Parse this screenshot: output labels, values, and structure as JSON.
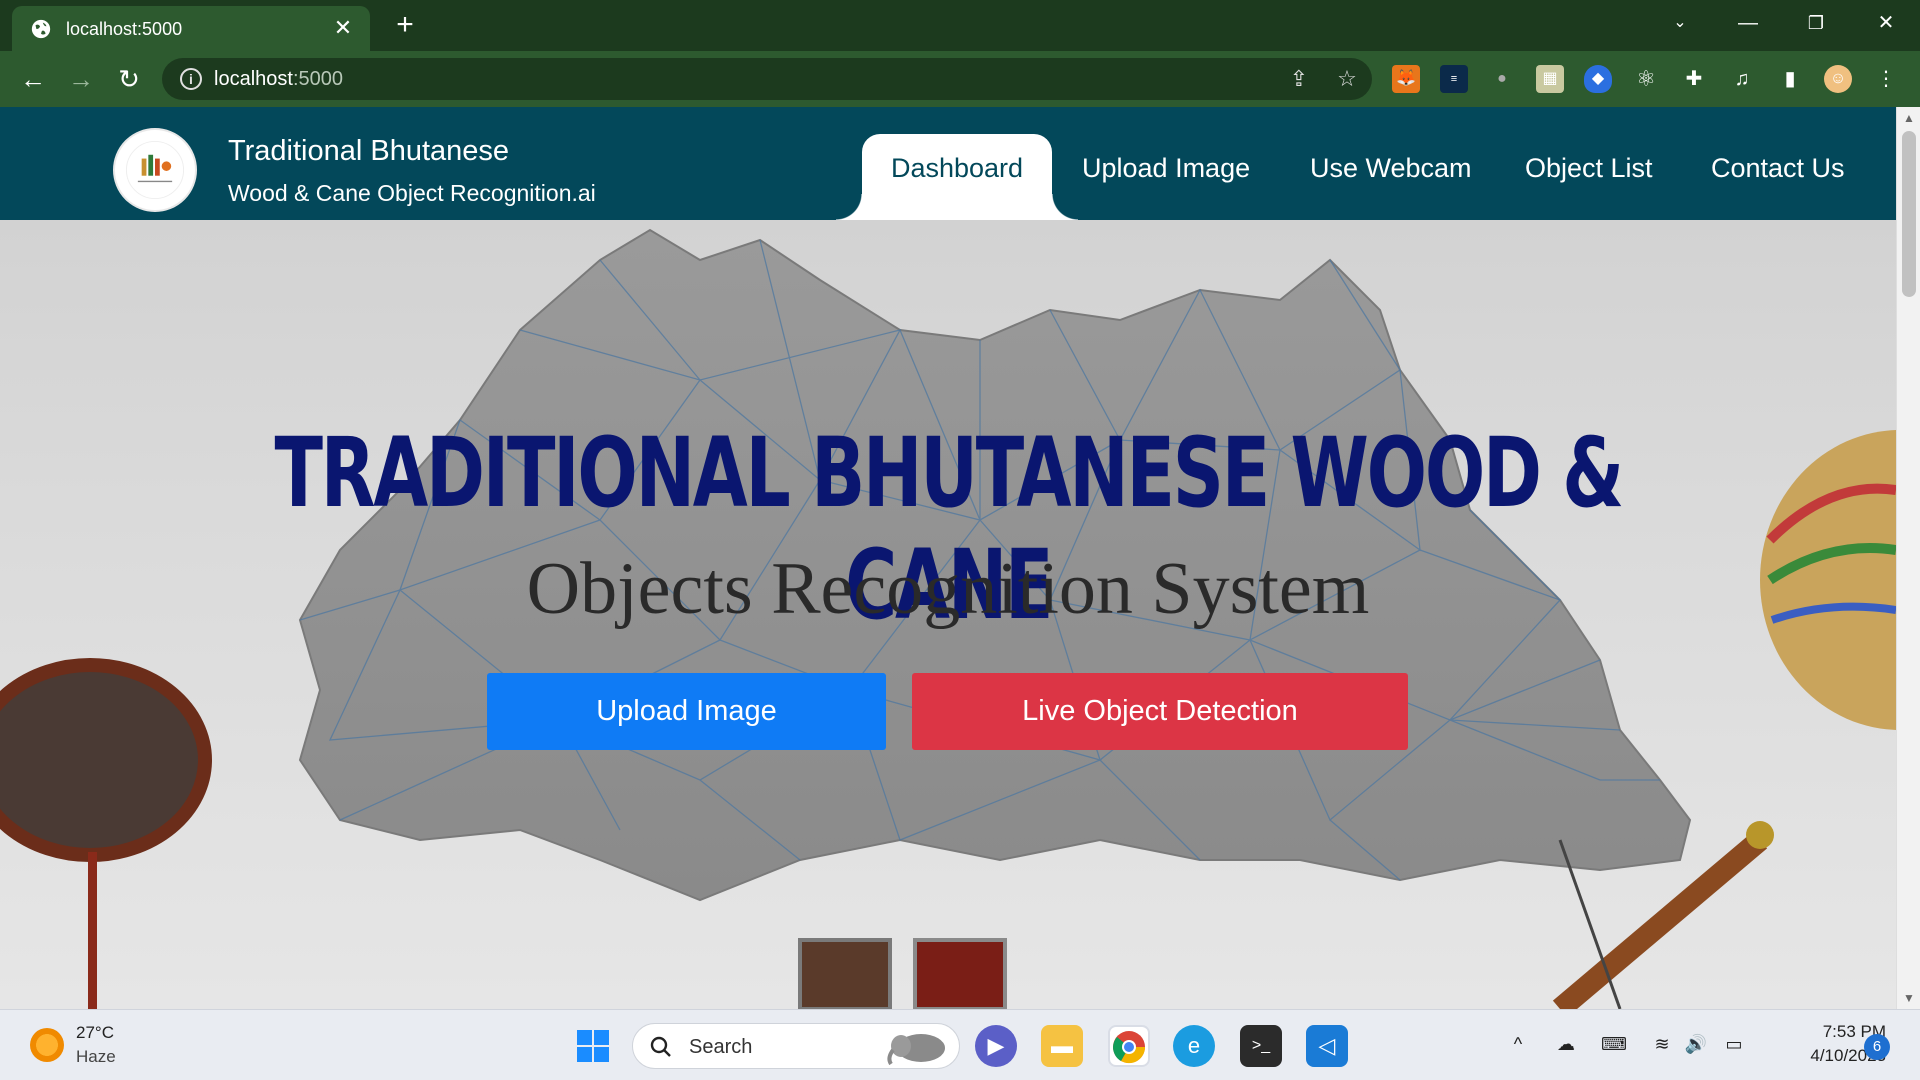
{
  "browser": {
    "tab_title": "localhost:5000",
    "url_host": "localhost",
    "url_port": ":5000"
  },
  "site": {
    "brand_line1": "Traditional Bhutanese",
    "brand_line2": "Wood & Cane Object Recognition.ai",
    "logo_text_1": "TRADITIONAL BHUTANESE",
    "logo_text_2": "Wood & Cane Object Detection",
    "nav": {
      "dashboard": "Dashboard",
      "upload": "Upload Image",
      "webcam": "Use Webcam",
      "objects": "Object List",
      "contact": "Contact Us"
    },
    "active_nav": "Dashboard"
  },
  "hero": {
    "title": "TRADITIONAL BHUTANESE WOOD & CANE",
    "subtitle": "Objects Recognition System",
    "primary_button": "Upload Image",
    "secondary_button": "Live Object Detection",
    "colors": {
      "title": "#0a1670",
      "primary": "#0f7bf5",
      "secondary": "#dc3545",
      "navbar": "#03485a"
    }
  },
  "taskbar": {
    "weather_temp": "27°C",
    "weather_desc": "Haze",
    "search_placeholder": "Search",
    "time": "7:53 PM",
    "date": "4/10/2023",
    "notification_count": "6"
  }
}
